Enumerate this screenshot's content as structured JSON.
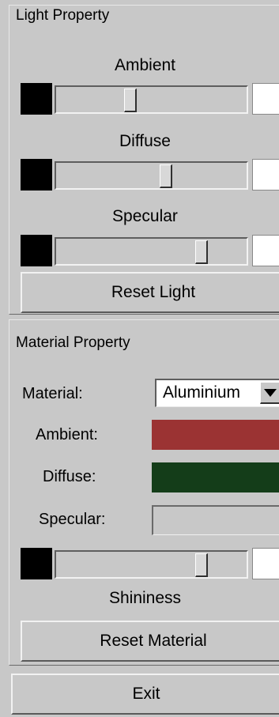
{
  "light": {
    "title": "Light Property",
    "ambient_label": "Ambient",
    "diffuse_label": "Diffuse",
    "specular_label": "Specular",
    "ambient_level": 0.38,
    "diffuse_level": 0.58,
    "specular_level": 0.78,
    "reset_label": "Reset Light"
  },
  "material": {
    "title": "Material Property",
    "material_label": "Material:",
    "material_value": "Aluminium",
    "ambient_label": "Ambient:",
    "diffuse_label": "Diffuse:",
    "specular_label": "Specular:",
    "ambient_color": "#9b3333",
    "diffuse_color": "#143d19",
    "specular_color": "#c8c8c8",
    "shininess_label": "Shininess",
    "shininess_level": 0.78,
    "reset_label": "Reset Material"
  },
  "exit_label": "Exit"
}
